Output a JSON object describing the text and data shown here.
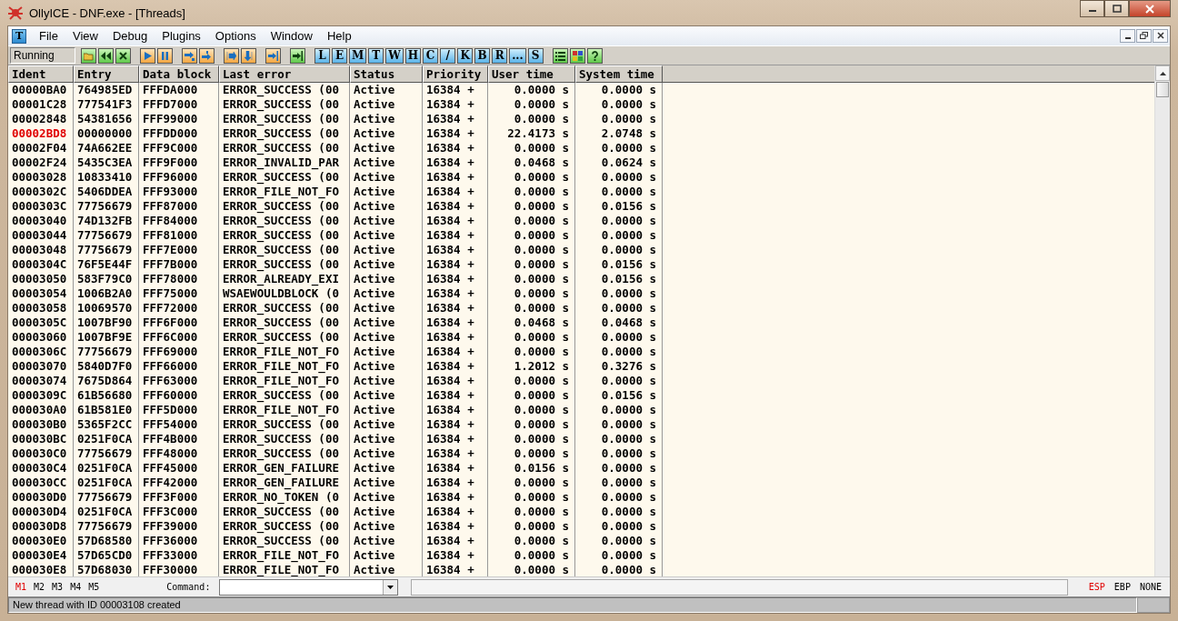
{
  "window": {
    "title": "OllyICE - DNF.exe - [Threads]"
  },
  "menubar": {
    "child_icon": "T",
    "items": [
      "File",
      "View",
      "Debug",
      "Plugins",
      "Options",
      "Window",
      "Help"
    ]
  },
  "toolbar": {
    "state": "Running",
    "letter_buttons": [
      "L",
      "E",
      "M",
      "T",
      "W",
      "H",
      "C",
      "/",
      "K",
      "B",
      "R",
      "...",
      "S"
    ]
  },
  "table": {
    "columns": [
      "Ident",
      "Entry",
      "Data block",
      "Last error",
      "Status",
      "Priority",
      "User time",
      "System time"
    ],
    "rows": [
      {
        "ident": "00000BA0",
        "entry": "764985ED",
        "data_block": "FFFDA000",
        "last_error": "ERROR_SUCCESS (00",
        "status": "Active",
        "priority": "16384 +",
        "user_time": "0.0000 s",
        "system_time": "0.0000 s",
        "current": false
      },
      {
        "ident": "00001C28",
        "entry": "777541F3",
        "data_block": "FFFD7000",
        "last_error": "ERROR_SUCCESS (00",
        "status": "Active",
        "priority": "16384 +",
        "user_time": "0.0000 s",
        "system_time": "0.0000 s",
        "current": false
      },
      {
        "ident": "00002848",
        "entry": "54381656",
        "data_block": "FFF99000",
        "last_error": "ERROR_SUCCESS (00",
        "status": "Active",
        "priority": "16384 +",
        "user_time": "0.0000 s",
        "system_time": "0.0000 s",
        "current": false
      },
      {
        "ident": "00002BD8",
        "entry": "00000000",
        "data_block": "FFFDD000",
        "last_error": "ERROR_SUCCESS (00",
        "status": "Active",
        "priority": "16384 +",
        "user_time": "22.4173 s",
        "system_time": "2.0748 s",
        "current": true
      },
      {
        "ident": "00002F04",
        "entry": "74A662EE",
        "data_block": "FFF9C000",
        "last_error": "ERROR_SUCCESS (00",
        "status": "Active",
        "priority": "16384 +",
        "user_time": "0.0000 s",
        "system_time": "0.0000 s",
        "current": false
      },
      {
        "ident": "00002F24",
        "entry": "5435C3EA",
        "data_block": "FFF9F000",
        "last_error": "ERROR_INVALID_PAR",
        "status": "Active",
        "priority": "16384 +",
        "user_time": "0.0468 s",
        "system_time": "0.0624 s",
        "current": false
      },
      {
        "ident": "00003028",
        "entry": "10833410",
        "data_block": "FFF96000",
        "last_error": "ERROR_SUCCESS (00",
        "status": "Active",
        "priority": "16384 +",
        "user_time": "0.0000 s",
        "system_time": "0.0000 s",
        "current": false
      },
      {
        "ident": "0000302C",
        "entry": "5406DDEA",
        "data_block": "FFF93000",
        "last_error": "ERROR_FILE_NOT_FO",
        "status": "Active",
        "priority": "16384 +",
        "user_time": "0.0000 s",
        "system_time": "0.0000 s",
        "current": false
      },
      {
        "ident": "0000303C",
        "entry": "77756679",
        "data_block": "FFF87000",
        "last_error": "ERROR_SUCCESS (00",
        "status": "Active",
        "priority": "16384 +",
        "user_time": "0.0000 s",
        "system_time": "0.0156 s",
        "current": false
      },
      {
        "ident": "00003040",
        "entry": "74D132FB",
        "data_block": "FFF84000",
        "last_error": "ERROR_SUCCESS (00",
        "status": "Active",
        "priority": "16384 +",
        "user_time": "0.0000 s",
        "system_time": "0.0000 s",
        "current": false
      },
      {
        "ident": "00003044",
        "entry": "77756679",
        "data_block": "FFF81000",
        "last_error": "ERROR_SUCCESS (00",
        "status": "Active",
        "priority": "16384 +",
        "user_time": "0.0000 s",
        "system_time": "0.0000 s",
        "current": false
      },
      {
        "ident": "00003048",
        "entry": "77756679",
        "data_block": "FFF7E000",
        "last_error": "ERROR_SUCCESS (00",
        "status": "Active",
        "priority": "16384 +",
        "user_time": "0.0000 s",
        "system_time": "0.0000 s",
        "current": false
      },
      {
        "ident": "0000304C",
        "entry": "76F5E44F",
        "data_block": "FFF7B000",
        "last_error": "ERROR_SUCCESS (00",
        "status": "Active",
        "priority": "16384 +",
        "user_time": "0.0000 s",
        "system_time": "0.0156 s",
        "current": false
      },
      {
        "ident": "00003050",
        "entry": "583F79C0",
        "data_block": "FFF78000",
        "last_error": "ERROR_ALREADY_EXI",
        "status": "Active",
        "priority": "16384 +",
        "user_time": "0.0000 s",
        "system_time": "0.0156 s",
        "current": false
      },
      {
        "ident": "00003054",
        "entry": "1006B2A0",
        "data_block": "FFF75000",
        "last_error": "WSAEWOULDBLOCK (0",
        "status": "Active",
        "priority": "16384 +",
        "user_time": "0.0000 s",
        "system_time": "0.0000 s",
        "current": false
      },
      {
        "ident": "00003058",
        "entry": "10069570",
        "data_block": "FFF72000",
        "last_error": "ERROR_SUCCESS (00",
        "status": "Active",
        "priority": "16384 +",
        "user_time": "0.0000 s",
        "system_time": "0.0000 s",
        "current": false
      },
      {
        "ident": "0000305C",
        "entry": "1007BF90",
        "data_block": "FFF6F000",
        "last_error": "ERROR_SUCCESS (00",
        "status": "Active",
        "priority": "16384 +",
        "user_time": "0.0468 s",
        "system_time": "0.0468 s",
        "current": false
      },
      {
        "ident": "00003060",
        "entry": "1007BF9E",
        "data_block": "FFF6C000",
        "last_error": "ERROR_SUCCESS (00",
        "status": "Active",
        "priority": "16384 +",
        "user_time": "0.0000 s",
        "system_time": "0.0000 s",
        "current": false
      },
      {
        "ident": "0000306C",
        "entry": "77756679",
        "data_block": "FFF69000",
        "last_error": "ERROR_FILE_NOT_FO",
        "status": "Active",
        "priority": "16384 +",
        "user_time": "0.0000 s",
        "system_time": "0.0000 s",
        "current": false
      },
      {
        "ident": "00003070",
        "entry": "5840D7F0",
        "data_block": "FFF66000",
        "last_error": "ERROR_FILE_NOT_FO",
        "status": "Active",
        "priority": "16384 +",
        "user_time": "1.2012 s",
        "system_time": "0.3276 s",
        "current": false
      },
      {
        "ident": "00003074",
        "entry": "7675D864",
        "data_block": "FFF63000",
        "last_error": "ERROR_FILE_NOT_FO",
        "status": "Active",
        "priority": "16384 +",
        "user_time": "0.0000 s",
        "system_time": "0.0000 s",
        "current": false
      },
      {
        "ident": "0000309C",
        "entry": "61B56680",
        "data_block": "FFF60000",
        "last_error": "ERROR_SUCCESS (00",
        "status": "Active",
        "priority": "16384 +",
        "user_time": "0.0000 s",
        "system_time": "0.0156 s",
        "current": false
      },
      {
        "ident": "000030A0",
        "entry": "61B581E0",
        "data_block": "FFF5D000",
        "last_error": "ERROR_FILE_NOT_FO",
        "status": "Active",
        "priority": "16384 +",
        "user_time": "0.0000 s",
        "system_time": "0.0000 s",
        "current": false
      },
      {
        "ident": "000030B0",
        "entry": "5365F2CC",
        "data_block": "FFF54000",
        "last_error": "ERROR_SUCCESS (00",
        "status": "Active",
        "priority": "16384 +",
        "user_time": "0.0000 s",
        "system_time": "0.0000 s",
        "current": false
      },
      {
        "ident": "000030BC",
        "entry": "0251F0CA",
        "data_block": "FFF4B000",
        "last_error": "ERROR_SUCCESS (00",
        "status": "Active",
        "priority": "16384 +",
        "user_time": "0.0000 s",
        "system_time": "0.0000 s",
        "current": false
      },
      {
        "ident": "000030C0",
        "entry": "77756679",
        "data_block": "FFF48000",
        "last_error": "ERROR_SUCCESS (00",
        "status": "Active",
        "priority": "16384 +",
        "user_time": "0.0000 s",
        "system_time": "0.0000 s",
        "current": false
      },
      {
        "ident": "000030C4",
        "entry": "0251F0CA",
        "data_block": "FFF45000",
        "last_error": "ERROR_GEN_FAILURE",
        "status": "Active",
        "priority": "16384 +",
        "user_time": "0.0156 s",
        "system_time": "0.0000 s",
        "current": false
      },
      {
        "ident": "000030CC",
        "entry": "0251F0CA",
        "data_block": "FFF42000",
        "last_error": "ERROR_GEN_FAILURE",
        "status": "Active",
        "priority": "16384 +",
        "user_time": "0.0000 s",
        "system_time": "0.0000 s",
        "current": false
      },
      {
        "ident": "000030D0",
        "entry": "77756679",
        "data_block": "FFF3F000",
        "last_error": "ERROR_NO_TOKEN (0",
        "status": "Active",
        "priority": "16384 +",
        "user_time": "0.0000 s",
        "system_time": "0.0000 s",
        "current": false
      },
      {
        "ident": "000030D4",
        "entry": "0251F0CA",
        "data_block": "FFF3C000",
        "last_error": "ERROR_SUCCESS (00",
        "status": "Active",
        "priority": "16384 +",
        "user_time": "0.0000 s",
        "system_time": "0.0000 s",
        "current": false
      },
      {
        "ident": "000030D8",
        "entry": "77756679",
        "data_block": "FFF39000",
        "last_error": "ERROR_SUCCESS (00",
        "status": "Active",
        "priority": "16384 +",
        "user_time": "0.0000 s",
        "system_time": "0.0000 s",
        "current": false
      },
      {
        "ident": "000030E0",
        "entry": "57D68580",
        "data_block": "FFF36000",
        "last_error": "ERROR_SUCCESS (00",
        "status": "Active",
        "priority": "16384 +",
        "user_time": "0.0000 s",
        "system_time": "0.0000 s",
        "current": false
      },
      {
        "ident": "000030E4",
        "entry": "57D65CD0",
        "data_block": "FFF33000",
        "last_error": "ERROR_FILE_NOT_FO",
        "status": "Active",
        "priority": "16384 +",
        "user_time": "0.0000 s",
        "system_time": "0.0000 s",
        "current": false
      },
      {
        "ident": "000030E8",
        "entry": "57D68030",
        "data_block": "FFF30000",
        "last_error": "ERROR_FILE_NOT_FO",
        "status": "Active",
        "priority": "16384 +",
        "user_time": "0.0000 s",
        "system_time": "0.0000 s",
        "current": false
      }
    ]
  },
  "command_bar": {
    "memory_tabs": [
      {
        "label": "M1",
        "selected": true
      },
      {
        "label": "M2",
        "selected": false
      },
      {
        "label": "M3",
        "selected": false
      },
      {
        "label": "M4",
        "selected": false
      },
      {
        "label": "M5",
        "selected": false
      }
    ],
    "command_label": "Command:",
    "registers": [
      {
        "label": "ESP",
        "selected": true
      },
      {
        "label": "EBP",
        "selected": false
      },
      {
        "label": "NONE",
        "selected": false
      }
    ]
  },
  "status_bar": {
    "message": "New thread with ID 00003108 created"
  }
}
